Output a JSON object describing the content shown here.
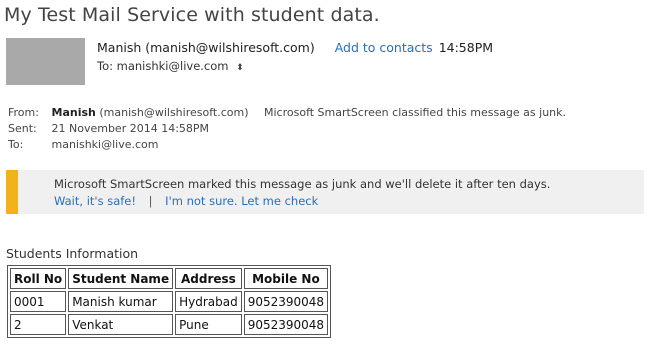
{
  "email": {
    "subject": "My Test Mail Service with student data.",
    "sender": "Manish (manish@wilshiresoft.com)",
    "add_to_contacts": "Add to contacts",
    "time": "14:58PM",
    "to_line": "To: manishki@live.com"
  },
  "details": {
    "from_label": "From:",
    "from_name": "Manish",
    "from_email": "(manish@wilshiresoft.com)",
    "smartscreen_note": "Microsoft SmartScreen classified this message as junk.",
    "sent_label": "Sent:",
    "sent_value": "21 November 2014 14:58PM",
    "to_label": "To:",
    "to_value": "manishki@live.com"
  },
  "junk_banner": {
    "message": "Microsoft SmartScreen marked this message as junk and we'll delete it after ten days.",
    "safe_link": "Wait, it's safe!",
    "separator": "|",
    "check_link": "I'm not sure. Let me check",
    "accent_color": "#f2b21c"
  },
  "students": {
    "title": "Students Information",
    "headers": [
      "Roll No",
      "Student Name",
      "Address",
      "Mobile No"
    ],
    "rows": [
      [
        "0001",
        "Manish kumar",
        "Hydrabad",
        "9052390048"
      ],
      [
        "2",
        "Venkat",
        "Pune",
        "9052390048"
      ]
    ]
  },
  "colors": {
    "link": "#2a6fb5",
    "avatar": "#a9a9a9",
    "banner_bg": "#f0f0f0"
  },
  "icons": {
    "pin": "pin-icon"
  }
}
